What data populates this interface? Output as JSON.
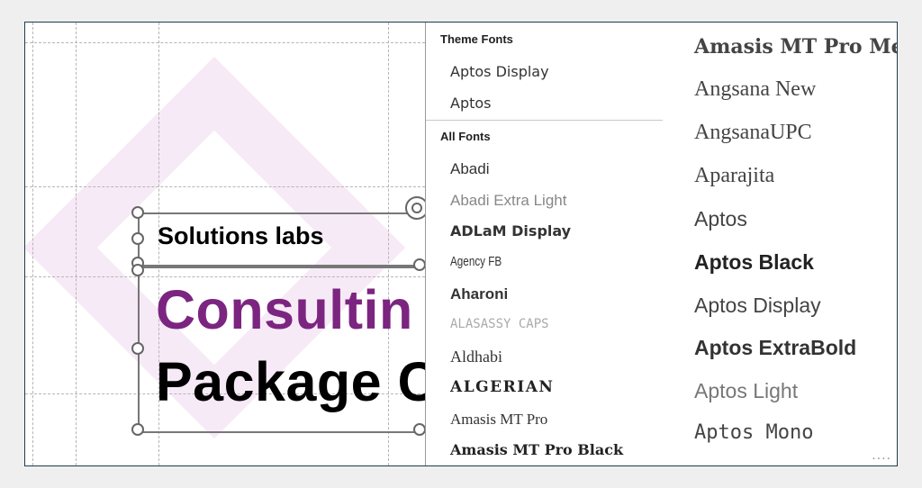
{
  "slide": {
    "subtitle": "Solutions labs",
    "headline_line1": "Consultin",
    "headline_line2": "Package C",
    "accent_color": "#7b2580"
  },
  "font_menu": {
    "theme_section": "Theme Fonts",
    "theme_fonts": [
      "Aptos Display",
      "Aptos"
    ],
    "all_section": "All Fonts",
    "all_fonts": [
      "Abadi",
      "Abadi Extra Light",
      "ADLaM Display",
      "Agency FB",
      "Aharoni",
      "ALASASSY CAPS",
      "Aldhabi",
      "ALGERIAN",
      "Amasis MT Pro",
      "Amasis MT Pro Black"
    ]
  },
  "font_gallery": {
    "fonts": [
      "Amasis MT Pro Medium",
      "Angsana New",
      "AngsanaUPC",
      "Aparajita",
      "Aptos",
      "Aptos Black",
      "Aptos Display",
      "Aptos ExtraBold",
      "Aptos Light",
      "Aptos Mono"
    ],
    "more_indicator": "...."
  }
}
